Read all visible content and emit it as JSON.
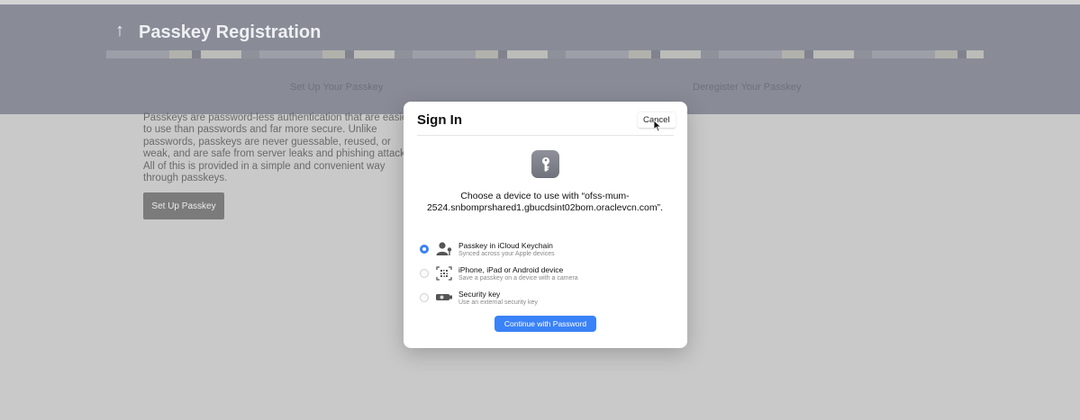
{
  "page": {
    "title": "Passkey Registration",
    "tabs": [
      "Set Up Your Passkey",
      "Deregister Your Passkey"
    ],
    "description": "Passkeys are password-less authentication that are easier to use than passwords and far more secure. Unlike passwords, passkeys are never guessable, reused, or weak, and are safe from server leaks and phishing attacks. All of this is provided in a simple and convenient way through passkeys.",
    "setup_button": "Set Up Passkey"
  },
  "dialog": {
    "title": "Sign In",
    "cancel": "Cancel",
    "prompt": "Choose a device to use with “ofss-mum-2524.snbomprshared1.gbucdsint02bom.oraclevcn.com”.",
    "options": [
      {
        "label": "Passkey in iCloud Keychain",
        "desc": "Synced across your Apple devices",
        "selected": true,
        "icon": "person-key-icon"
      },
      {
        "label": "iPhone, iPad or Android device",
        "desc": "Save a passkey on a device with a camera",
        "selected": false,
        "icon": "qr-code-icon"
      },
      {
        "label": "Security key",
        "desc": "Use an external security key",
        "selected": false,
        "icon": "security-key-icon"
      }
    ],
    "continue": "Continue with Password"
  },
  "colors": {
    "accent": "#3a82f7",
    "header": "#898c97",
    "overlay": "#c9c9c9"
  }
}
